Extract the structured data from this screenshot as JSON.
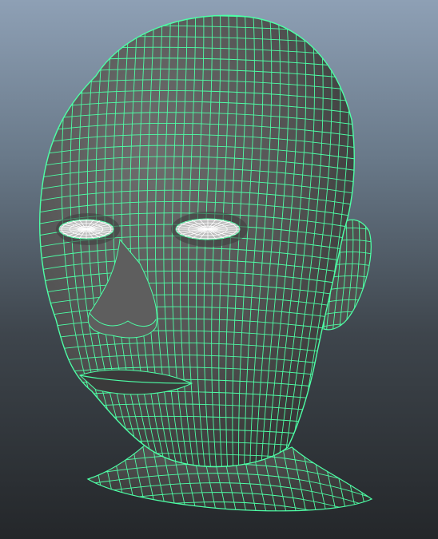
{
  "viewport": {
    "object": "head-mesh",
    "display_mode": "wireframe-on-shaded",
    "colors": {
      "wire": "#4dffa6",
      "eye_wire": "#ffffff",
      "shade_light": "#6a6a6a",
      "shade_mid": "#4f4f4f",
      "shade_dark": "#2f2f2f",
      "background_top": "#8ea0b5",
      "background_bottom": "#24272a"
    }
  }
}
